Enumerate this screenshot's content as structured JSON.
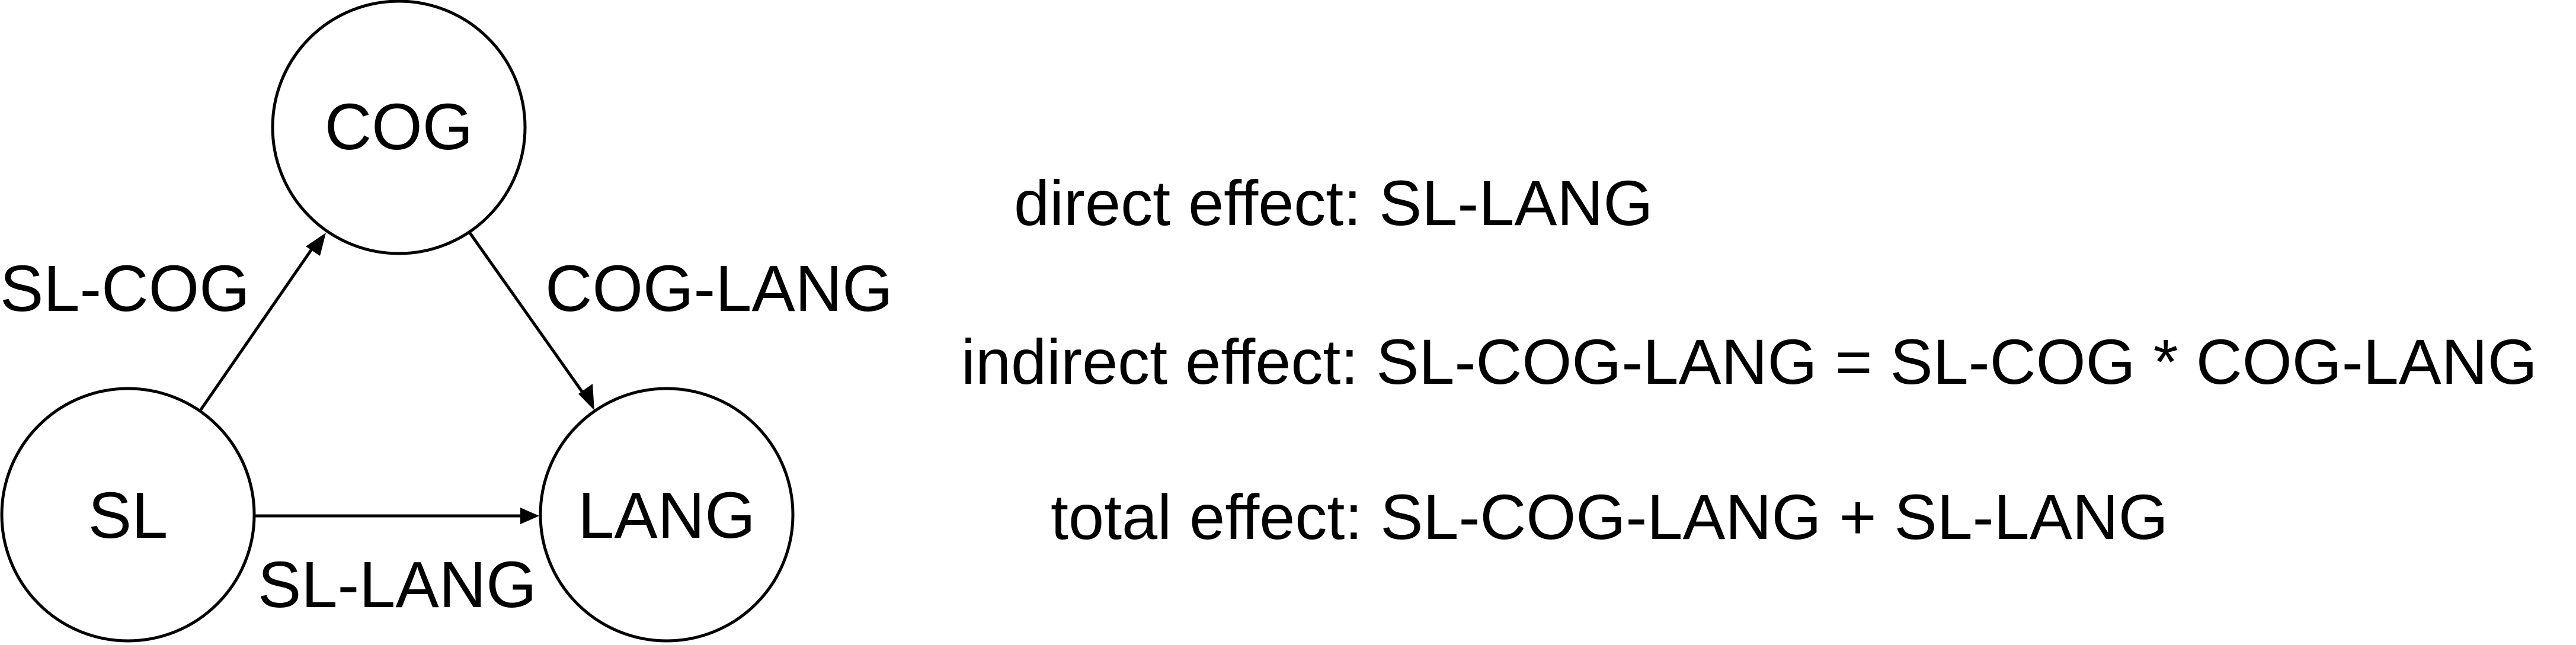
{
  "nodes": {
    "cog": "COG",
    "sl": "SL",
    "lang": "LANG"
  },
  "edges": {
    "sl_cog": "SL-COG",
    "cog_lang": "COG-LANG",
    "sl_lang": "SL-LANG"
  },
  "formulas": {
    "direct": "direct effect: SL-LANG",
    "indirect": "indirect effect: SL-COG-LANG = SL-COG * COG-LANG",
    "total": "total effect: SL-COG-LANG + SL-LANG"
  }
}
